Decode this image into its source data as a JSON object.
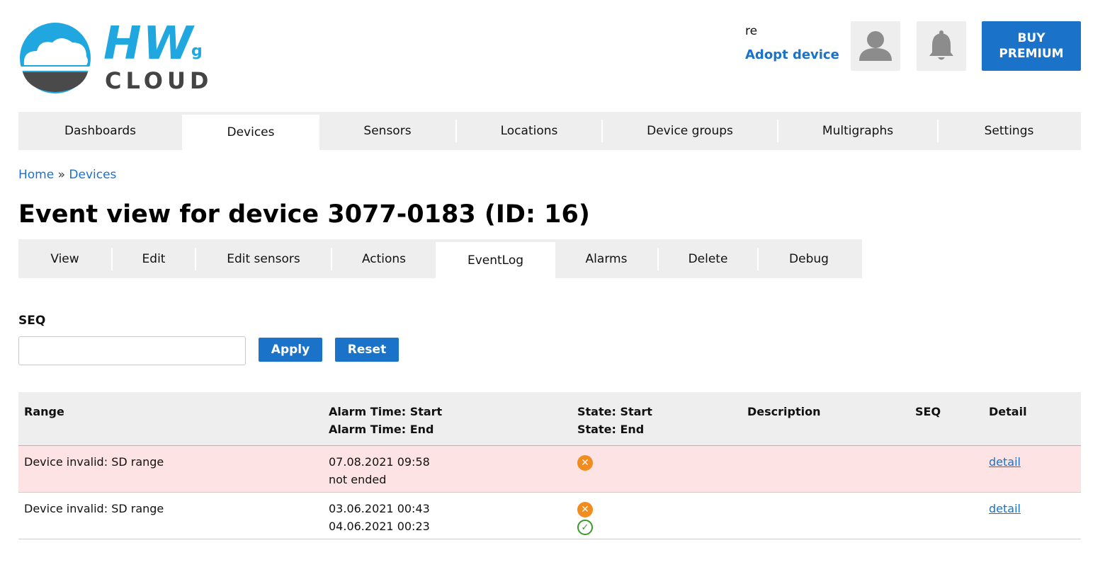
{
  "header": {
    "logo": {
      "text_main": "HW",
      "text_sub": "g",
      "text_cloud": "CLOUD",
      "brand_color": "#21a7e0"
    },
    "user_name": "re",
    "adopt_label": "Adopt device",
    "buy_label_line1": "BUY",
    "buy_label_line2": "PREMIUM",
    "user_icon": "user-icon",
    "bell_icon": "bell-icon",
    "accent": "#1a72c9"
  },
  "main_nav": {
    "tabs": [
      {
        "label": "Dashboards"
      },
      {
        "label": "Devices"
      },
      {
        "label": "Sensors"
      },
      {
        "label": "Locations"
      },
      {
        "label": "Device groups"
      },
      {
        "label": "Multigraphs"
      },
      {
        "label": "Settings"
      }
    ],
    "active": "Devices"
  },
  "breadcrumb": {
    "home": "Home",
    "sep": "»",
    "current": "Devices"
  },
  "page_title": "Event view for device 3077-0183 (ID: 16)",
  "sub_nav": {
    "tabs": [
      {
        "label": "View"
      },
      {
        "label": "Edit"
      },
      {
        "label": "Edit sensors"
      },
      {
        "label": "Actions"
      },
      {
        "label": "EventLog"
      },
      {
        "label": "Alarms"
      },
      {
        "label": "Delete"
      },
      {
        "label": "Debug"
      }
    ],
    "active": "EventLog"
  },
  "filter": {
    "seq_label": "SEQ",
    "seq_value": "",
    "apply_label": "Apply",
    "reset_label": "Reset"
  },
  "table": {
    "headers": {
      "range": "Range",
      "time_start": "Alarm Time: Start",
      "time_end": "Alarm Time: End",
      "state_start": "State: Start",
      "state_end": "State: End",
      "description": "Description",
      "seq": "SEQ",
      "detail": "Detail"
    },
    "rows": [
      {
        "range": "Device invalid: SD range",
        "time_start": "07.08.2021 09:58",
        "time_end": "not ended",
        "state_start_icon": "error-icon",
        "state_end_icon": "",
        "description": "",
        "seq": "",
        "detail": "detail",
        "alarm": true
      },
      {
        "range": "Device invalid: SD range",
        "time_start": "03.06.2021 00:43",
        "time_end": "04.06.2021 00:23",
        "state_start_icon": "error-icon",
        "state_end_icon": "check-icon",
        "description": "",
        "seq": "",
        "detail": "detail",
        "alarm": false
      }
    ],
    "alarm_row_color": "#fde3e3",
    "error_color": "#f28c1e",
    "ok_color": "#3a9a2a"
  }
}
